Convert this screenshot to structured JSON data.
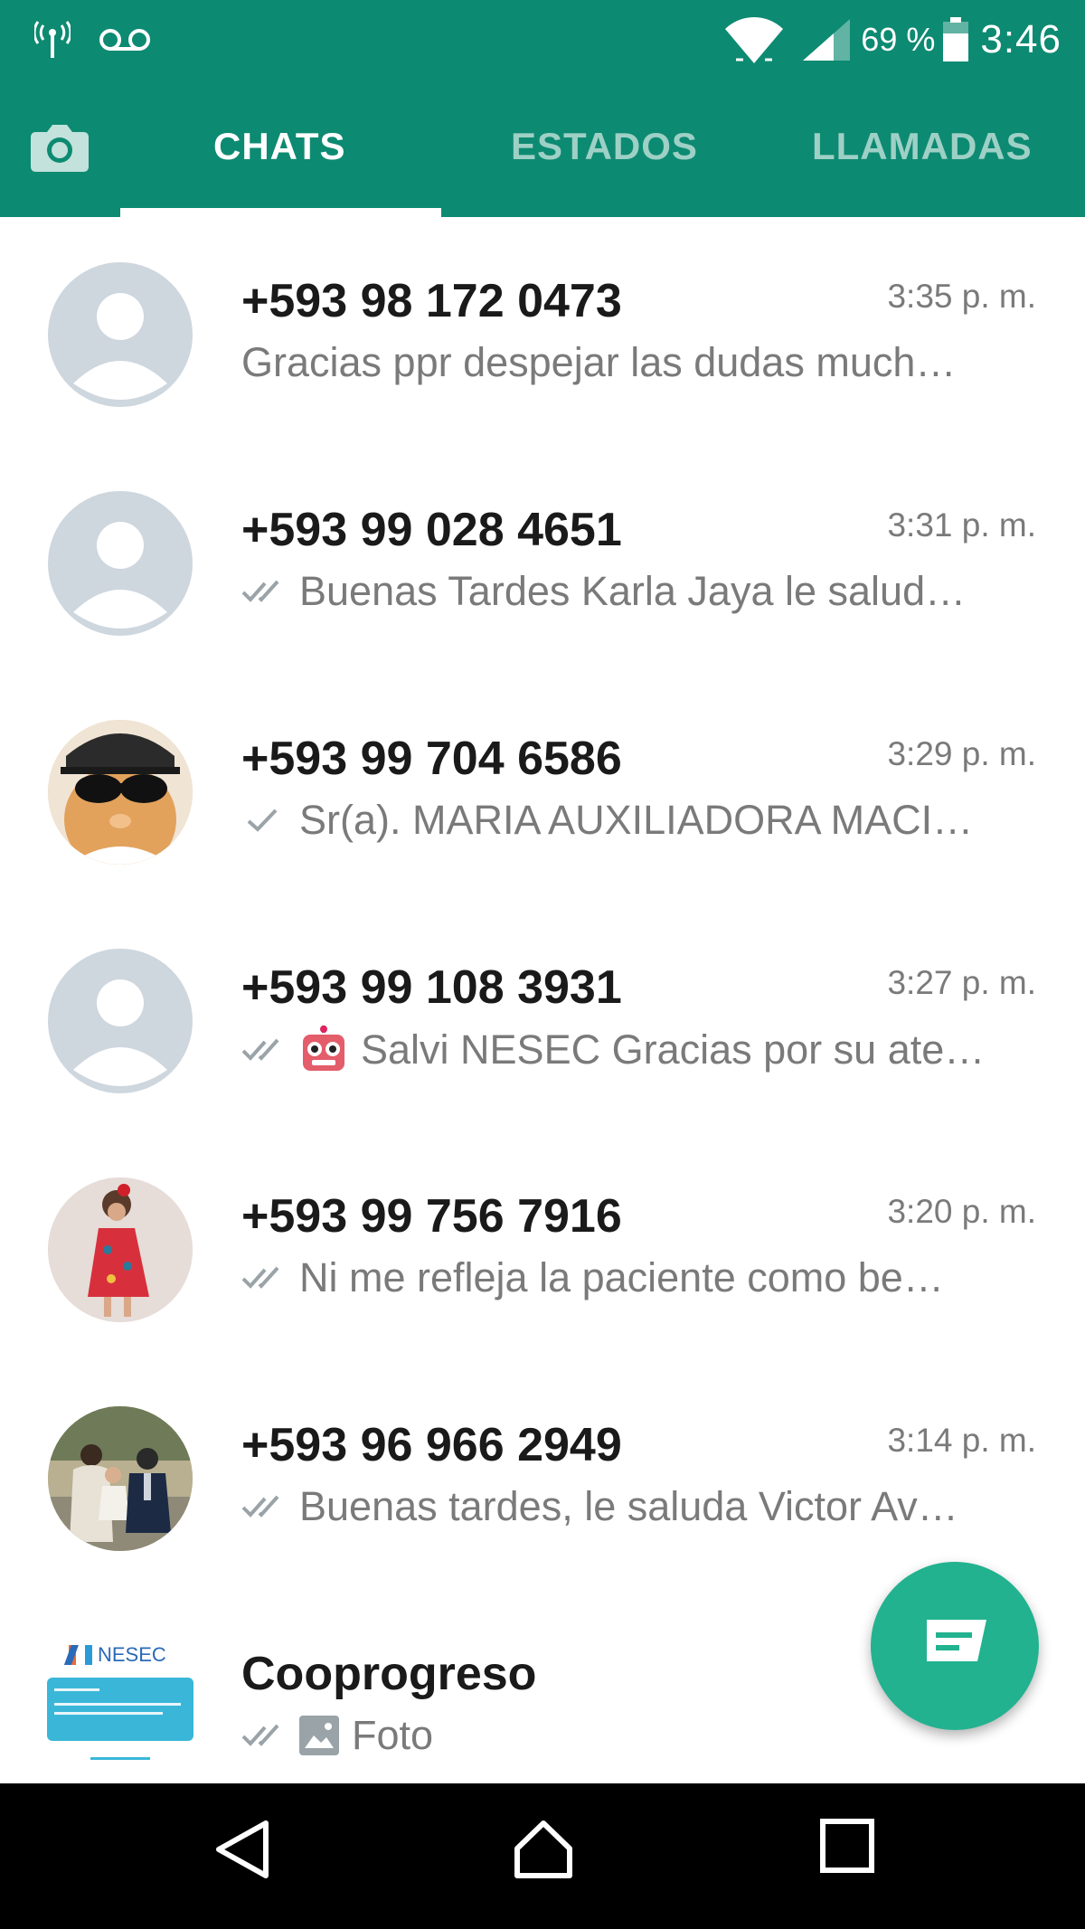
{
  "status_bar": {
    "battery_percent": "69 %",
    "time": "3:46"
  },
  "tabs": {
    "chats": "CHATS",
    "estados": "ESTADOS",
    "llamadas": "LLAMADAS"
  },
  "chats": [
    {
      "name": "+593 98 172 0473",
      "time": "3:35 p. m.",
      "preview": "Gracias ppr despejar las dudas much…",
      "ticks": "none"
    },
    {
      "name": "+593 99 028 4651",
      "time": "3:31 p. m.",
      "preview": "Buenas Tardes Karla Jaya le salud…",
      "ticks": "double"
    },
    {
      "name": "+593 99 704 6586",
      "time": "3:29 p. m.",
      "preview": "Sr(a). MARIA AUXILIADORA MACI…",
      "ticks": "single"
    },
    {
      "name": "+593 99 108 3931",
      "time": "3:27 p. m.",
      "preview": "Salvi NESEC Gracias por su ate…",
      "ticks": "double",
      "emoji": "robot"
    },
    {
      "name": "+593 99 756 7916",
      "time": "3:20 p. m.",
      "preview": "Ni me refleja la paciente como be…",
      "ticks": "double"
    },
    {
      "name": "+593 96 966 2949",
      "time": "3:14 p. m.",
      "preview": "Buenas tardes, le saluda Victor Av…",
      "ticks": "double"
    },
    {
      "name": "Cooprogreso",
      "time": "",
      "preview": "Foto",
      "ticks": "double",
      "media": "photo-icon"
    }
  ],
  "nesec_avatar": {
    "logo_text": "NESEC"
  },
  "colors": {
    "header": "#0d8a72",
    "fab": "#22b28f",
    "tick": "#9aa3a8"
  }
}
